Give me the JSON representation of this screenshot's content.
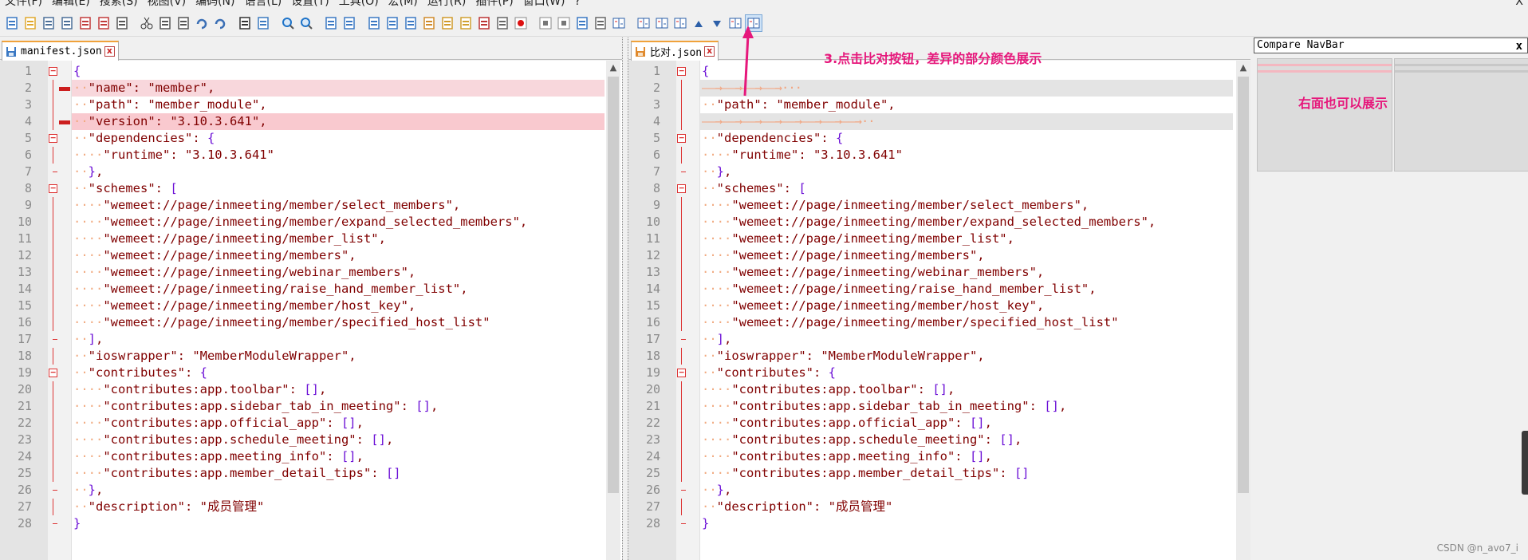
{
  "menu": [
    "文件(F)",
    "编辑(E)",
    "搜索(S)",
    "视图(V)",
    "编码(N)",
    "语言(L)",
    "设置(T)",
    "工具(O)",
    "宏(M)",
    "运行(R)",
    "插件(P)",
    "窗口(W)",
    "?"
  ],
  "window_close": "X",
  "toolbar_icons": [
    "new-file-icon",
    "open-file-icon",
    "save-icon",
    "save-all-icon",
    "close-icon",
    "close-all-icon",
    "print-icon",
    "cut-icon",
    "copy-icon",
    "paste-icon",
    "undo-icon",
    "redo-icon",
    "find-icon",
    "replace-icon",
    "zoom-in-icon",
    "zoom-out-icon",
    "sync-vertical-icon",
    "sync-horizontal-icon",
    "word-wrap-icon",
    "show-all-chars-icon",
    "indent-guide-icon",
    "user-language-icon",
    "function-list-icon",
    "folder-workspace-icon",
    "document-map-icon",
    "monitoring-icon",
    "record-macro-icon",
    "stop-record-icon",
    "play-macro-icon",
    "run-macro-multiple-icon",
    "save-macro-icon",
    "compare-set-first-icon",
    "compare-icon",
    "compare-clear-icon",
    "compare-first-diff-icon",
    "compare-prev-diff-icon",
    "compare-next-diff-icon",
    "compare-last-diff-icon",
    "compare-navbar-icon"
  ],
  "left_tab": {
    "name": "manifest.json",
    "close": "x"
  },
  "right_tab": {
    "name": "比对.json",
    "close": "x"
  },
  "annotations": {
    "step3": "3.点击比对按钮，差异的部分颜色展示",
    "right_side": "右面也可以展示"
  },
  "navbar": {
    "title": "Compare NavBar",
    "close": "x"
  },
  "watermark": "CSDN @n_avo7_i",
  "colors": {
    "removed": "#f8d7dc",
    "removed_strong": "#f9c9cf",
    "blank": "#e4e4e4",
    "keyword": "#800000",
    "bracket": "#6b0fd6",
    "whitespace": "#f1a97f",
    "annotation": "#e6177b"
  },
  "left_lines": [
    {
      "n": "1",
      "ws": "",
      "text": "{",
      "hl": ""
    },
    {
      "n": "2",
      "ws": "··",
      "text": "\"name\": \"member\",",
      "hl": "removed"
    },
    {
      "n": "3",
      "ws": "··",
      "text": "\"path\": \"member_module\",",
      "hl": ""
    },
    {
      "n": "4",
      "ws": "··",
      "text": "\"version\": \"3.10.3.641\",",
      "hl": "removed_strong"
    },
    {
      "n": "5",
      "ws": "··",
      "text": "\"dependencies\": {",
      "hl": ""
    },
    {
      "n": "6",
      "ws": "····",
      "text": "\"runtime\": \"3.10.3.641\"",
      "hl": ""
    },
    {
      "n": "7",
      "ws": "··",
      "text": "},",
      "hl": ""
    },
    {
      "n": "8",
      "ws": "··",
      "text": "\"schemes\": [",
      "hl": ""
    },
    {
      "n": "9",
      "ws": "····",
      "text": "\"wemeet://page/inmeeting/member/select_members\",",
      "hl": ""
    },
    {
      "n": "10",
      "ws": "····",
      "text": "\"wemeet://page/inmeeting/member/expand_selected_members\",",
      "hl": ""
    },
    {
      "n": "11",
      "ws": "····",
      "text": "\"wemeet://page/inmeeting/member_list\",",
      "hl": ""
    },
    {
      "n": "12",
      "ws": "····",
      "text": "\"wemeet://page/inmeeting/members\",",
      "hl": ""
    },
    {
      "n": "13",
      "ws": "····",
      "text": "\"wemeet://page/inmeeting/webinar_members\",",
      "hl": ""
    },
    {
      "n": "14",
      "ws": "····",
      "text": "\"wemeet://page/inmeeting/raise_hand_member_list\",",
      "hl": ""
    },
    {
      "n": "15",
      "ws": "····",
      "text": "\"wemeet://page/inmeeting/member/host_key\",",
      "hl": ""
    },
    {
      "n": "16",
      "ws": "····",
      "text": "\"wemeet://page/inmeeting/member/specified_host_list\"",
      "hl": ""
    },
    {
      "n": "17",
      "ws": "··",
      "text": "],",
      "hl": ""
    },
    {
      "n": "18",
      "ws": "··",
      "text": "\"ioswrapper\": \"MemberModuleWrapper\",",
      "hl": ""
    },
    {
      "n": "19",
      "ws": "··",
      "text": "\"contributes\": {",
      "hl": ""
    },
    {
      "n": "20",
      "ws": "····",
      "text": "\"contributes:app.toolbar\": [],",
      "hl": ""
    },
    {
      "n": "21",
      "ws": "····",
      "text": "\"contributes:app.sidebar_tab_in_meeting\": [],",
      "hl": ""
    },
    {
      "n": "22",
      "ws": "····",
      "text": "\"contributes:app.official_app\": [],",
      "hl": ""
    },
    {
      "n": "23",
      "ws": "····",
      "text": "\"contributes:app.schedule_meeting\": [],",
      "hl": ""
    },
    {
      "n": "24",
      "ws": "····",
      "text": "\"contributes:app.meeting_info\": [],",
      "hl": ""
    },
    {
      "n": "25",
      "ws": "····",
      "text": "\"contributes:app.member_detail_tips\": []",
      "hl": ""
    },
    {
      "n": "26",
      "ws": "··",
      "text": "},",
      "hl": ""
    },
    {
      "n": "27",
      "ws": "··",
      "text": "\"description\": \"成员管理\"",
      "hl": ""
    },
    {
      "n": "28",
      "ws": "",
      "text": "}",
      "hl": ""
    }
  ],
  "right_lines": [
    {
      "n": "1",
      "ws": "",
      "text": "{",
      "hl": ""
    },
    {
      "n": "2",
      "ws": "",
      "text": "",
      "hl": "blank"
    },
    {
      "n": "3",
      "ws": "··",
      "text": "\"path\": \"member_module\",",
      "hl": ""
    },
    {
      "n": "4",
      "ws": "",
      "text": "",
      "hl": "blank"
    },
    {
      "n": "5",
      "ws": "··",
      "text": "\"dependencies\": {",
      "hl": ""
    },
    {
      "n": "6",
      "ws": "····",
      "text": "\"runtime\": \"3.10.3.641\"",
      "hl": ""
    },
    {
      "n": "7",
      "ws": "··",
      "text": "},",
      "hl": ""
    },
    {
      "n": "8",
      "ws": "··",
      "text": "\"schemes\": [",
      "hl": ""
    },
    {
      "n": "9",
      "ws": "····",
      "text": "\"wemeet://page/inmeeting/member/select_members\",",
      "hl": ""
    },
    {
      "n": "10",
      "ws": "····",
      "text": "\"wemeet://page/inmeeting/member/expand_selected_members\",",
      "hl": ""
    },
    {
      "n": "11",
      "ws": "····",
      "text": "\"wemeet://page/inmeeting/member_list\",",
      "hl": ""
    },
    {
      "n": "12",
      "ws": "····",
      "text": "\"wemeet://page/inmeeting/members\",",
      "hl": ""
    },
    {
      "n": "13",
      "ws": "····",
      "text": "\"wemeet://page/inmeeting/webinar_members\",",
      "hl": ""
    },
    {
      "n": "14",
      "ws": "····",
      "text": "\"wemeet://page/inmeeting/raise_hand_member_list\",",
      "hl": ""
    },
    {
      "n": "15",
      "ws": "····",
      "text": "\"wemeet://page/inmeeting/member/host_key\",",
      "hl": ""
    },
    {
      "n": "16",
      "ws": "····",
      "text": "\"wemeet://page/inmeeting/member/specified_host_list\"",
      "hl": ""
    },
    {
      "n": "17",
      "ws": "··",
      "text": "],",
      "hl": ""
    },
    {
      "n": "18",
      "ws": "··",
      "text": "\"ioswrapper\": \"MemberModuleWrapper\",",
      "hl": ""
    },
    {
      "n": "19",
      "ws": "··",
      "text": "\"contributes\": {",
      "hl": ""
    },
    {
      "n": "20",
      "ws": "····",
      "text": "\"contributes:app.toolbar\": [],",
      "hl": ""
    },
    {
      "n": "21",
      "ws": "····",
      "text": "\"contributes:app.sidebar_tab_in_meeting\": [],",
      "hl": ""
    },
    {
      "n": "22",
      "ws": "····",
      "text": "\"contributes:app.official_app\": [],",
      "hl": ""
    },
    {
      "n": "23",
      "ws": "····",
      "text": "\"contributes:app.schedule_meeting\": [],",
      "hl": ""
    },
    {
      "n": "24",
      "ws": "····",
      "text": "\"contributes:app.meeting_info\": [],",
      "hl": ""
    },
    {
      "n": "25",
      "ws": "····",
      "text": "\"contributes:app.member_detail_tips\": []",
      "hl": ""
    },
    {
      "n": "26",
      "ws": "··",
      "text": "},",
      "hl": ""
    },
    {
      "n": "27",
      "ws": "··",
      "text": "\"description\": \"成员管理\"",
      "hl": ""
    },
    {
      "n": "28",
      "ws": "",
      "text": "}",
      "hl": ""
    }
  ]
}
